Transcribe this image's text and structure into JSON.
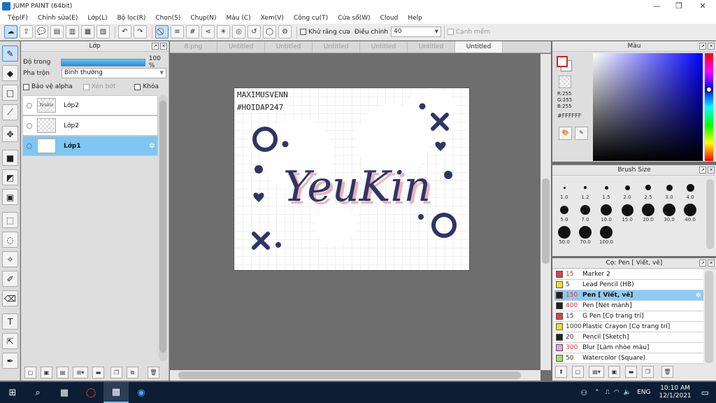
{
  "window": {
    "title": "JUMP PAINT (64bit)",
    "controls": [
      "—",
      "❐",
      "✕"
    ]
  },
  "menu": [
    "Tệp(F)",
    "Chỉnh sửa(E)",
    "Lớp(L)",
    "Bộ lọc(R)",
    "Chọn(S)",
    "Chụp(N)",
    "Màu (C)",
    "Xem(V)",
    "Công cụ(T)",
    "Cửa sổ(W)",
    "Cloud",
    "Help"
  ],
  "toolbar": {
    "antialias_label": "Khử răng cưa",
    "adjust_label": "Điều chỉnh",
    "adjust_value": "40",
    "edge_label": "Cạnh mềm"
  },
  "layer_panel": {
    "title": "Lớp",
    "opacity_label": "Độ trong",
    "opacity_value": "100 %",
    "opacity_level": 1.0,
    "blend_label": "Pha trộn",
    "blend_value": "Bình thường",
    "protect_alpha": "Bảo vệ alpha",
    "clip": "Xén bớt",
    "lock": "Khóa",
    "layers": [
      {
        "name": "Lớp2",
        "thumb": "Yeukin"
      },
      {
        "name": "Lớp2"
      },
      {
        "name": "Lớp1",
        "selected": true
      }
    ]
  },
  "tabs": [
    "8.png",
    "Untitled",
    "Untitled",
    "Untitled",
    "Untitled",
    "Untitled",
    "Untitled"
  ],
  "artwork": {
    "top_line1": "MAXIMUSVENN",
    "top_line2": "#HOIDAP247",
    "main_text": "YeuKin",
    "accent": "#2f3564"
  },
  "color_panel": {
    "title": "Màu",
    "r": "R:255",
    "g": "G:255",
    "b": "B:255",
    "hex": "#FFFFFF"
  },
  "brush_size": {
    "title": "Brush Size",
    "sizes": [
      "1.0",
      "1.2",
      "1.5",
      "2.0",
      "2.5",
      "3.0",
      "4.0",
      "5.0",
      "7.0",
      "10.0",
      "15.0",
      "20.0",
      "30.0",
      "40.0",
      "50.0",
      "70.0",
      "100.0"
    ]
  },
  "brush_list": {
    "title": "Cọ: Pen [ Viết, vẽ]",
    "items": [
      {
        "size": "15",
        "name": "Marker 2",
        "color": "#e04040",
        "red": true
      },
      {
        "size": "5",
        "name": "Lead Pencil (HB)",
        "color": "#f2e020"
      },
      {
        "size": "150",
        "name": "Pen [ Viết, vẽ]",
        "color": "#222222",
        "red": true,
        "selected": true
      },
      {
        "size": "400",
        "name": "Pen [Nét mảnh]",
        "color": "#222222",
        "red": true
      },
      {
        "size": "15",
        "name": "G Pen [Cọ trang trí]",
        "color": "#e04040"
      },
      {
        "size": "1000",
        "name": "Plastic Crayon [Cọ trang trí]",
        "color": "#f2e020"
      },
      {
        "size": "20",
        "name": "Pencil [Sketch]",
        "color": "#222222"
      },
      {
        "size": "300",
        "name": "Blur [Làm nhòe màu]",
        "color": "#f0a0e0",
        "red": true
      },
      {
        "size": "50",
        "name": "Watercolor (Square)",
        "color": "#a0e060"
      }
    ]
  },
  "taskbar": {
    "lang": "ENG",
    "time": "10:10 AM",
    "date": "12/1/2021"
  }
}
